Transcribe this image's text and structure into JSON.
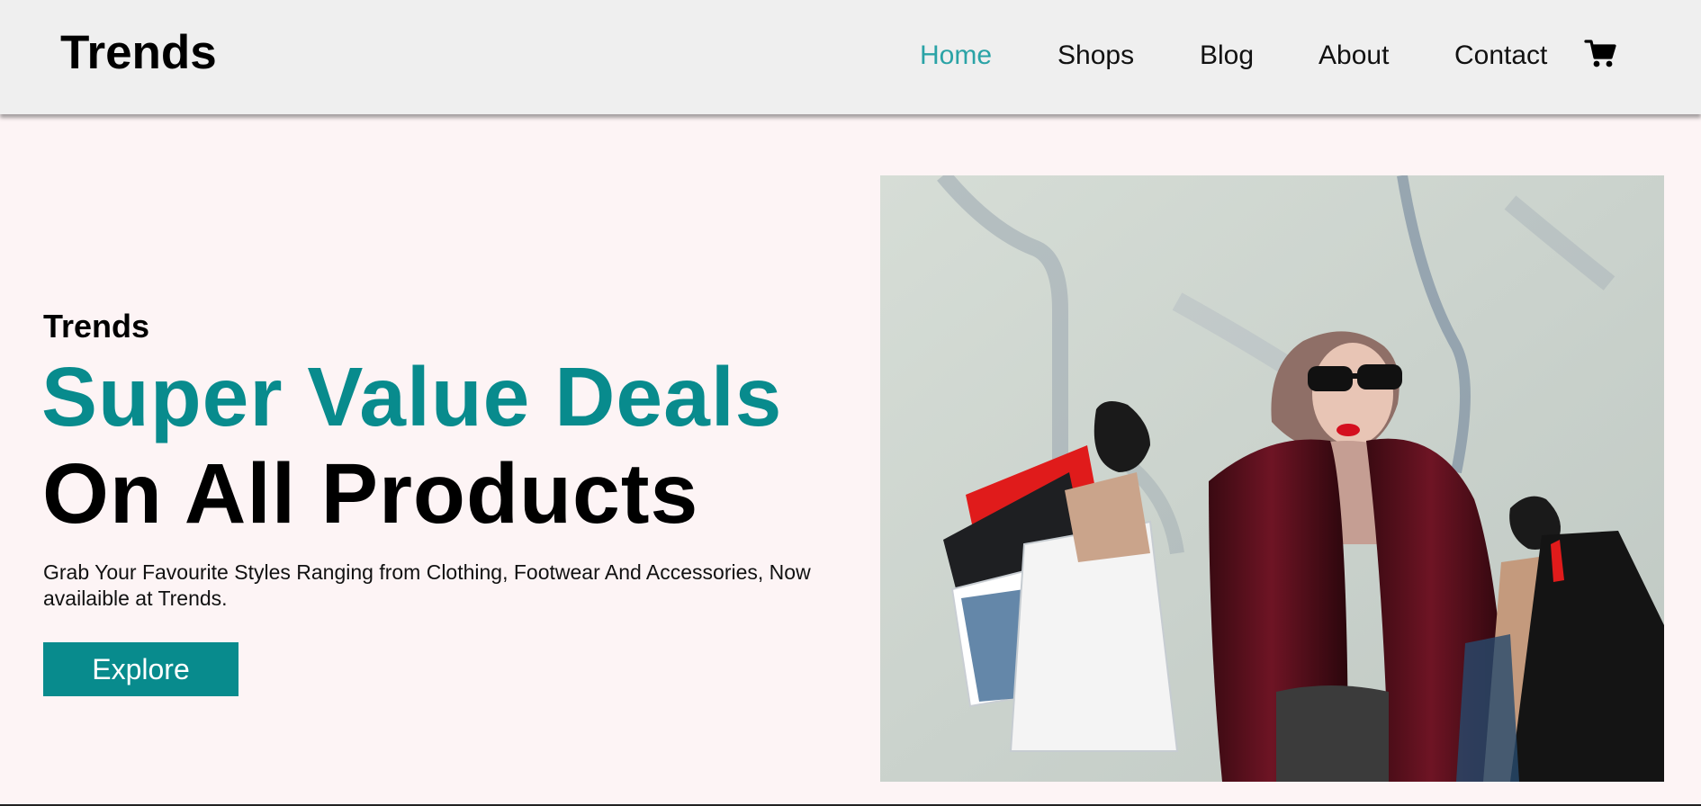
{
  "header": {
    "brand": "Trends",
    "nav": [
      {
        "label": "Home",
        "active": true
      },
      {
        "label": "Shops",
        "active": false
      },
      {
        "label": "Blog",
        "active": false
      },
      {
        "label": "About",
        "active": false
      },
      {
        "label": "Contact",
        "active": false
      }
    ],
    "cart_icon": "shopping-cart-icon"
  },
  "hero": {
    "subtitle": "Trends",
    "headline": "Super Value Deals",
    "headline2": "On All Products",
    "description": "Grab Your Favourite Styles Ranging from Clothing, Footwear And Accessories, Now availaible at Trends.",
    "cta": "Explore",
    "image_subject": "woman with shopping bags"
  },
  "colors": {
    "accent": "#088b8d",
    "nav_active": "#2aa3a6",
    "header_bg": "#efefef",
    "page_bg": "#fdf4f5"
  }
}
